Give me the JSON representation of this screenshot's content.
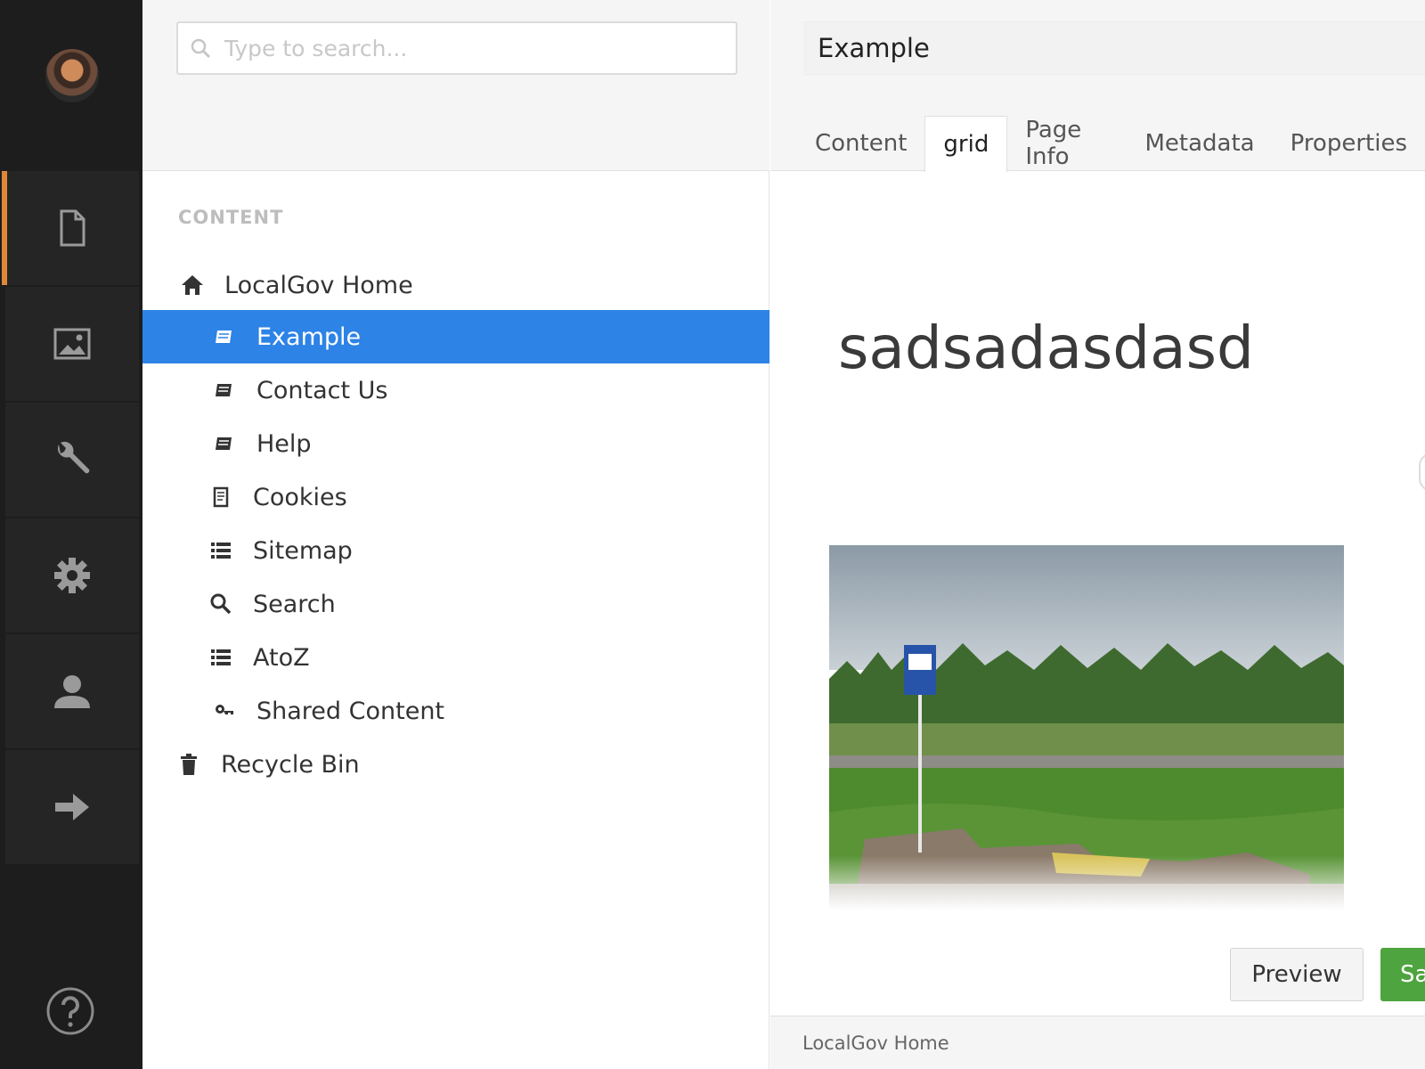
{
  "search": {
    "placeholder": "Type to search..."
  },
  "tree": {
    "section_title": "CONTENT",
    "items": [
      {
        "label": "LocalGov Home",
        "icon": "home-icon"
      },
      {
        "label": "Example",
        "icon": "document-icon",
        "selected": true
      },
      {
        "label": "Contact Us",
        "icon": "document-icon"
      },
      {
        "label": "Help",
        "icon": "document-icon"
      },
      {
        "label": "Cookies",
        "icon": "page-icon"
      },
      {
        "label": "Sitemap",
        "icon": "list-icon"
      },
      {
        "label": "Search",
        "icon": "search-icon"
      },
      {
        "label": "AtoZ",
        "icon": "list-icon"
      },
      {
        "label": "Shared Content",
        "icon": "key-icon"
      },
      {
        "label": "Recycle Bin",
        "icon": "trash-icon"
      }
    ]
  },
  "rail": {
    "items": [
      "content-icon",
      "media-icon",
      "wrench-icon",
      "settings-icon",
      "user-icon",
      "arrow-icon"
    ],
    "active_color": "#e1873a"
  },
  "editor": {
    "node_name": "Example",
    "tabs": [
      "Content",
      "grid",
      "Page Info",
      "Metadata",
      "Properties"
    ],
    "active_tab": "grid",
    "headline": "sadsadasdasd",
    "preview_label": "Preview",
    "save_label": "Save",
    "footer_breadcrumb": "LocalGov Home"
  },
  "colors": {
    "selected": "#2d83e6",
    "save": "#4ea43e"
  }
}
